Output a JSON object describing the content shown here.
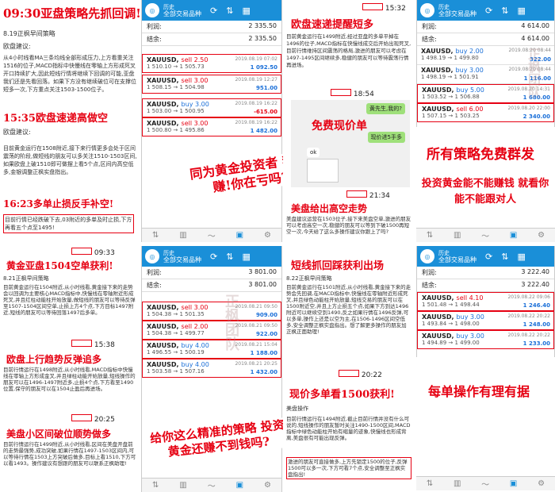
{
  "panel1": {
    "h1": "09:30亚盘策略先抓回调!",
    "date": "8.19正枫早间策略",
    "label": "欧盘建议:",
    "p1": "从4小时线看MA三条均线全部形成压力,上方看重关注1516的位子,MACD指标中快慢线在零轴上方形成死叉开口持续扩大,因此短线行情将继续下回调的可能,亚盘我们还是先看回落。如果下方没有继续破位可在支撑位短多一次,下方重点关注1503-1500位子。",
    "h2": "15:35欧盘速递高做空",
    "label2": "欧盘建议:",
    "p2": "目前黄金运行在1508附近,接下来行情更多会处于区间震荡的阶段,做短线的朋友可以多关注1510-1503区间,如果欧盘上破1510即可做摆上看5个点,区间内高空低多,金银调整正枫实盘指出。",
    "h3": "16:23多单止损反手补空!",
    "p3": "目前行情已经跌破下去,03附近的多单及时止损,下方再看五个点至1495!"
  },
  "phone1": {
    "app": "历史",
    "title": "全部交易品种",
    "sum": [
      {
        "label": "利润:",
        "val": "2 335.50"
      },
      {
        "label": "结余:",
        "val": "2 335.50"
      }
    ],
    "orders": [
      {
        "sym": "XAUUSD,",
        "side": "sell 2.50",
        "dir": "sell",
        "dt": "2019.08.19 07:02",
        "pr": "1 510.10 → 1 505.73",
        "pf": "1 092.50"
      },
      {
        "sym": "XAUUSD,",
        "side": "sell 3.00",
        "dir": "sell",
        "dt": "2019.08.19 12:27",
        "pr": "1 508.15 → 1 504.98",
        "pf": "951.00"
      },
      {
        "sym": "XAUUSD,",
        "side": "buy 3.00",
        "dir": "buy",
        "dt": "2019.08.19 16:22",
        "pr": "1 503.00 → 1 500.95",
        "pf": "-615.00"
      },
      {
        "sym": "XAUUSD,",
        "side": "sell 3.00",
        "dir": "sell",
        "dt": "2019.08.19 16:22",
        "pr": "1 500.80 → 1 495.86",
        "pf": "1 482.00"
      }
    ]
  },
  "mid1": "同为黄金投资者 我在赚!你在亏吗?",
  "panel3": {
    "time": "15:32",
    "h1": "欧盘速递提醒短多",
    "p1": "目前黄金运行在1499附近,经过亚盘的多单平掉在1496的位子,MACD指标在快慢线成交后开始出现死叉,目前行情维持区间震荡的格局,激进的朋友可以考虑在1497-1495区间继续多,稳健的朋友可以等待震荡行情再进场。",
    "time2": "18:54",
    "h2": "免费现价单",
    "chat1": "黄先生,我的?",
    "chat2": "现价进5手多",
    "chat3": "ok",
    "time3": "21:34",
    "h3": "美盘给出高空走势",
    "p3": "美盘建议运营在1503位子,接下来美盘空单,激进的朋友可以考虑高空一次,稳健的朋友可以等到下破1500再短空一次,今天给了这么多操作建议你跟上了吗?"
  },
  "phone2": {
    "app": "历史",
    "title": "全部交易品种",
    "sum": [
      {
        "label": "利润:",
        "val": "4 614.00"
      },
      {
        "label": "结余:",
        "val": "4 614.00"
      }
    ],
    "orders": [
      {
        "sym": "XAUUSD,",
        "side": "buy 2.00",
        "dir": "buy",
        "dt": "2019.08.20 08:44",
        "pr": "1 498.19 → 1 499.80",
        "pf": "322.00"
      },
      {
        "sym": "XAUUSD,",
        "side": "buy 3.00",
        "dir": "buy",
        "dt": "2019.08.20 08:44",
        "pr": "1 498.19 → 1 501.91",
        "pf": "1 116.00"
      },
      {
        "sym": "XAUUSD,",
        "side": "buy 5.00",
        "dir": "buy",
        "dt": "2019.08.20 14:31",
        "pr": "1 503.52 → 1 506.88",
        "pf": "1 680.00"
      },
      {
        "sym": "XAUUSD,",
        "side": "sell 6.00",
        "dir": "sell",
        "dt": "2019.08.20 22:00",
        "pr": "1 507.15 → 1 503.25",
        "pf": "2 340.00"
      }
    ]
  },
  "right1": "所有策略免费群发",
  "right2": "投资黄金能不能赚钱 就看你能不能跟对人",
  "panel5": {
    "time": "09:33",
    "h1": "黄金亚盘1504空单获利!",
    "date": "8.21正枫早间策略",
    "p1": "目前黄金运行在1504附近,从小时线看,黄金接下来的走势会以回调为主要核心MACD指标中,快慢线在零轴附近形成死叉,并且红柱动能柱开始放量,做短线的朋友可以等待反弹至1507-1504区间空单,止损上方4个点,下方目标1497附近,短线的朋友可以等待回落1497后多单。",
    "time2": "15:38",
    "h2": "欧盘上行趋势反弹追多",
    "p2": "目前行情运行在1498附近,从小时线看,MACD指标中快慢线在零轴上方形成金叉,并且绿柱动能开始放量,短线操作的朋友可以在1496-1497附近多,止损4个点,下方看至1490位置,保守的朋友可以在1504止盈后再进场。",
    "time3": "20:25",
    "h3": "美盘小区间破位顺势做多",
    "p3": "目前行情运行在1499附近,从小时线看,区间在美盘开盘前的走势最强势,成功突破,如果行情在1497-1503区间内,可以等待行情在1503上方突破后做多,目标上看1510,下方可以看1493。操作建议有想跟的朋友可以联系正枫助理!"
  },
  "phone3": {
    "app": "历史",
    "title": "全部交易品种",
    "sum": [
      {
        "label": "利润:",
        "val": "3 801.00"
      },
      {
        "label": "结余:",
        "val": "3 801.00"
      }
    ],
    "orders": [
      {
        "sym": "XAUUSD,",
        "side": "sell 3.00",
        "dir": "sell",
        "dt": "2019.08.21 09:50",
        "pr": "1 504.38 → 1 501.35",
        "pf": "909.00"
      },
      {
        "sym": "XAUUSD,",
        "side": "sell 2.00",
        "dir": "sell",
        "dt": "2019.08.21 09:50",
        "pr": "1 504.38 → 1 499.77",
        "pf": "922.00"
      },
      {
        "sym": "XAUUSD,",
        "side": "buy 4.00",
        "dir": "buy",
        "dt": "2019.08.21 15:04",
        "pr": "1 496.55 → 1 500.19",
        "pf": "1 188.00"
      },
      {
        "sym": "XAUUSD,",
        "side": "buy 4.00",
        "dir": "buy",
        "dt": "2019.08.21 20:25",
        "pr": "1 503.58 → 1 507.16",
        "pf": "1 432.00"
      }
    ]
  },
  "mid2": "给你这么精准的策略 投资黄金还赚不到钱吗?",
  "panel7": {
    "h1": "短线抓回踩获利出场",
    "date": "8.22正枫早间策略",
    "p1": "目前黄金运行在1501附近,从小时线看,黄金接下来的走势会先回调,在MACD指标中,快慢线在零轴附近形成死叉,并且绿色动能柱开始放量,短线交易的朋友可以在1500附近空,并且上方止损五个点,如果下方到达1496附近可以继续空到1490,反之如果行情在1496反弹,可以多单,操作上还是以空为主,在1506-1496区间空低多,安全调整正枫实盘指出。想了解更多操作的朋友加正枫正面助理!",
    "time": "20:22",
    "h2": "现价多单看1500获利!",
    "label": "美盘操作",
    "p2": "目前行情运行在1494附近,截止目前行情并没有什么可说的,短线操作的朋友暂时关注1490-1500区间,MACD指标中绿色动能柱开始有缩量的迹象,快慢线也形成背离,美盘很有可能出现反弹。",
    "hl": "激进的朋友可直接做多,上方先锁定1500的位子,反弹1500可以多一次,下方可看7个点,安全调整至正枫实盘指出!"
  },
  "phone4": {
    "app": "历史",
    "title": "全部交易品种",
    "sum": [
      {
        "label": "利润:",
        "val": "3 222.40"
      },
      {
        "label": "结余:",
        "val": "3 222.40"
      }
    ],
    "orders": [
      {
        "sym": "XAUUSD,",
        "side": "sell 4.10",
        "dir": "sell",
        "dt": "2019.08.22 09:06",
        "pr": "1 501.48 → 1 498.44",
        "pf": "1 246.40"
      },
      {
        "sym": "XAUUSD,",
        "side": "buy 3.00",
        "dir": "buy",
        "dt": "2019.08.22 20:22",
        "pr": "1 493.84 → 1 498.00",
        "pf": "1 248.00"
      },
      {
        "sym": "XAUUSD,",
        "side": "buy 3.00",
        "dir": "buy",
        "dt": "2019.08.22 20:22",
        "pr": "1 494.89 → 1 499.00",
        "pf": "1 233.00"
      }
    ]
  },
  "right3": "每单操作有理有据",
  "wm": "正枫团队"
}
